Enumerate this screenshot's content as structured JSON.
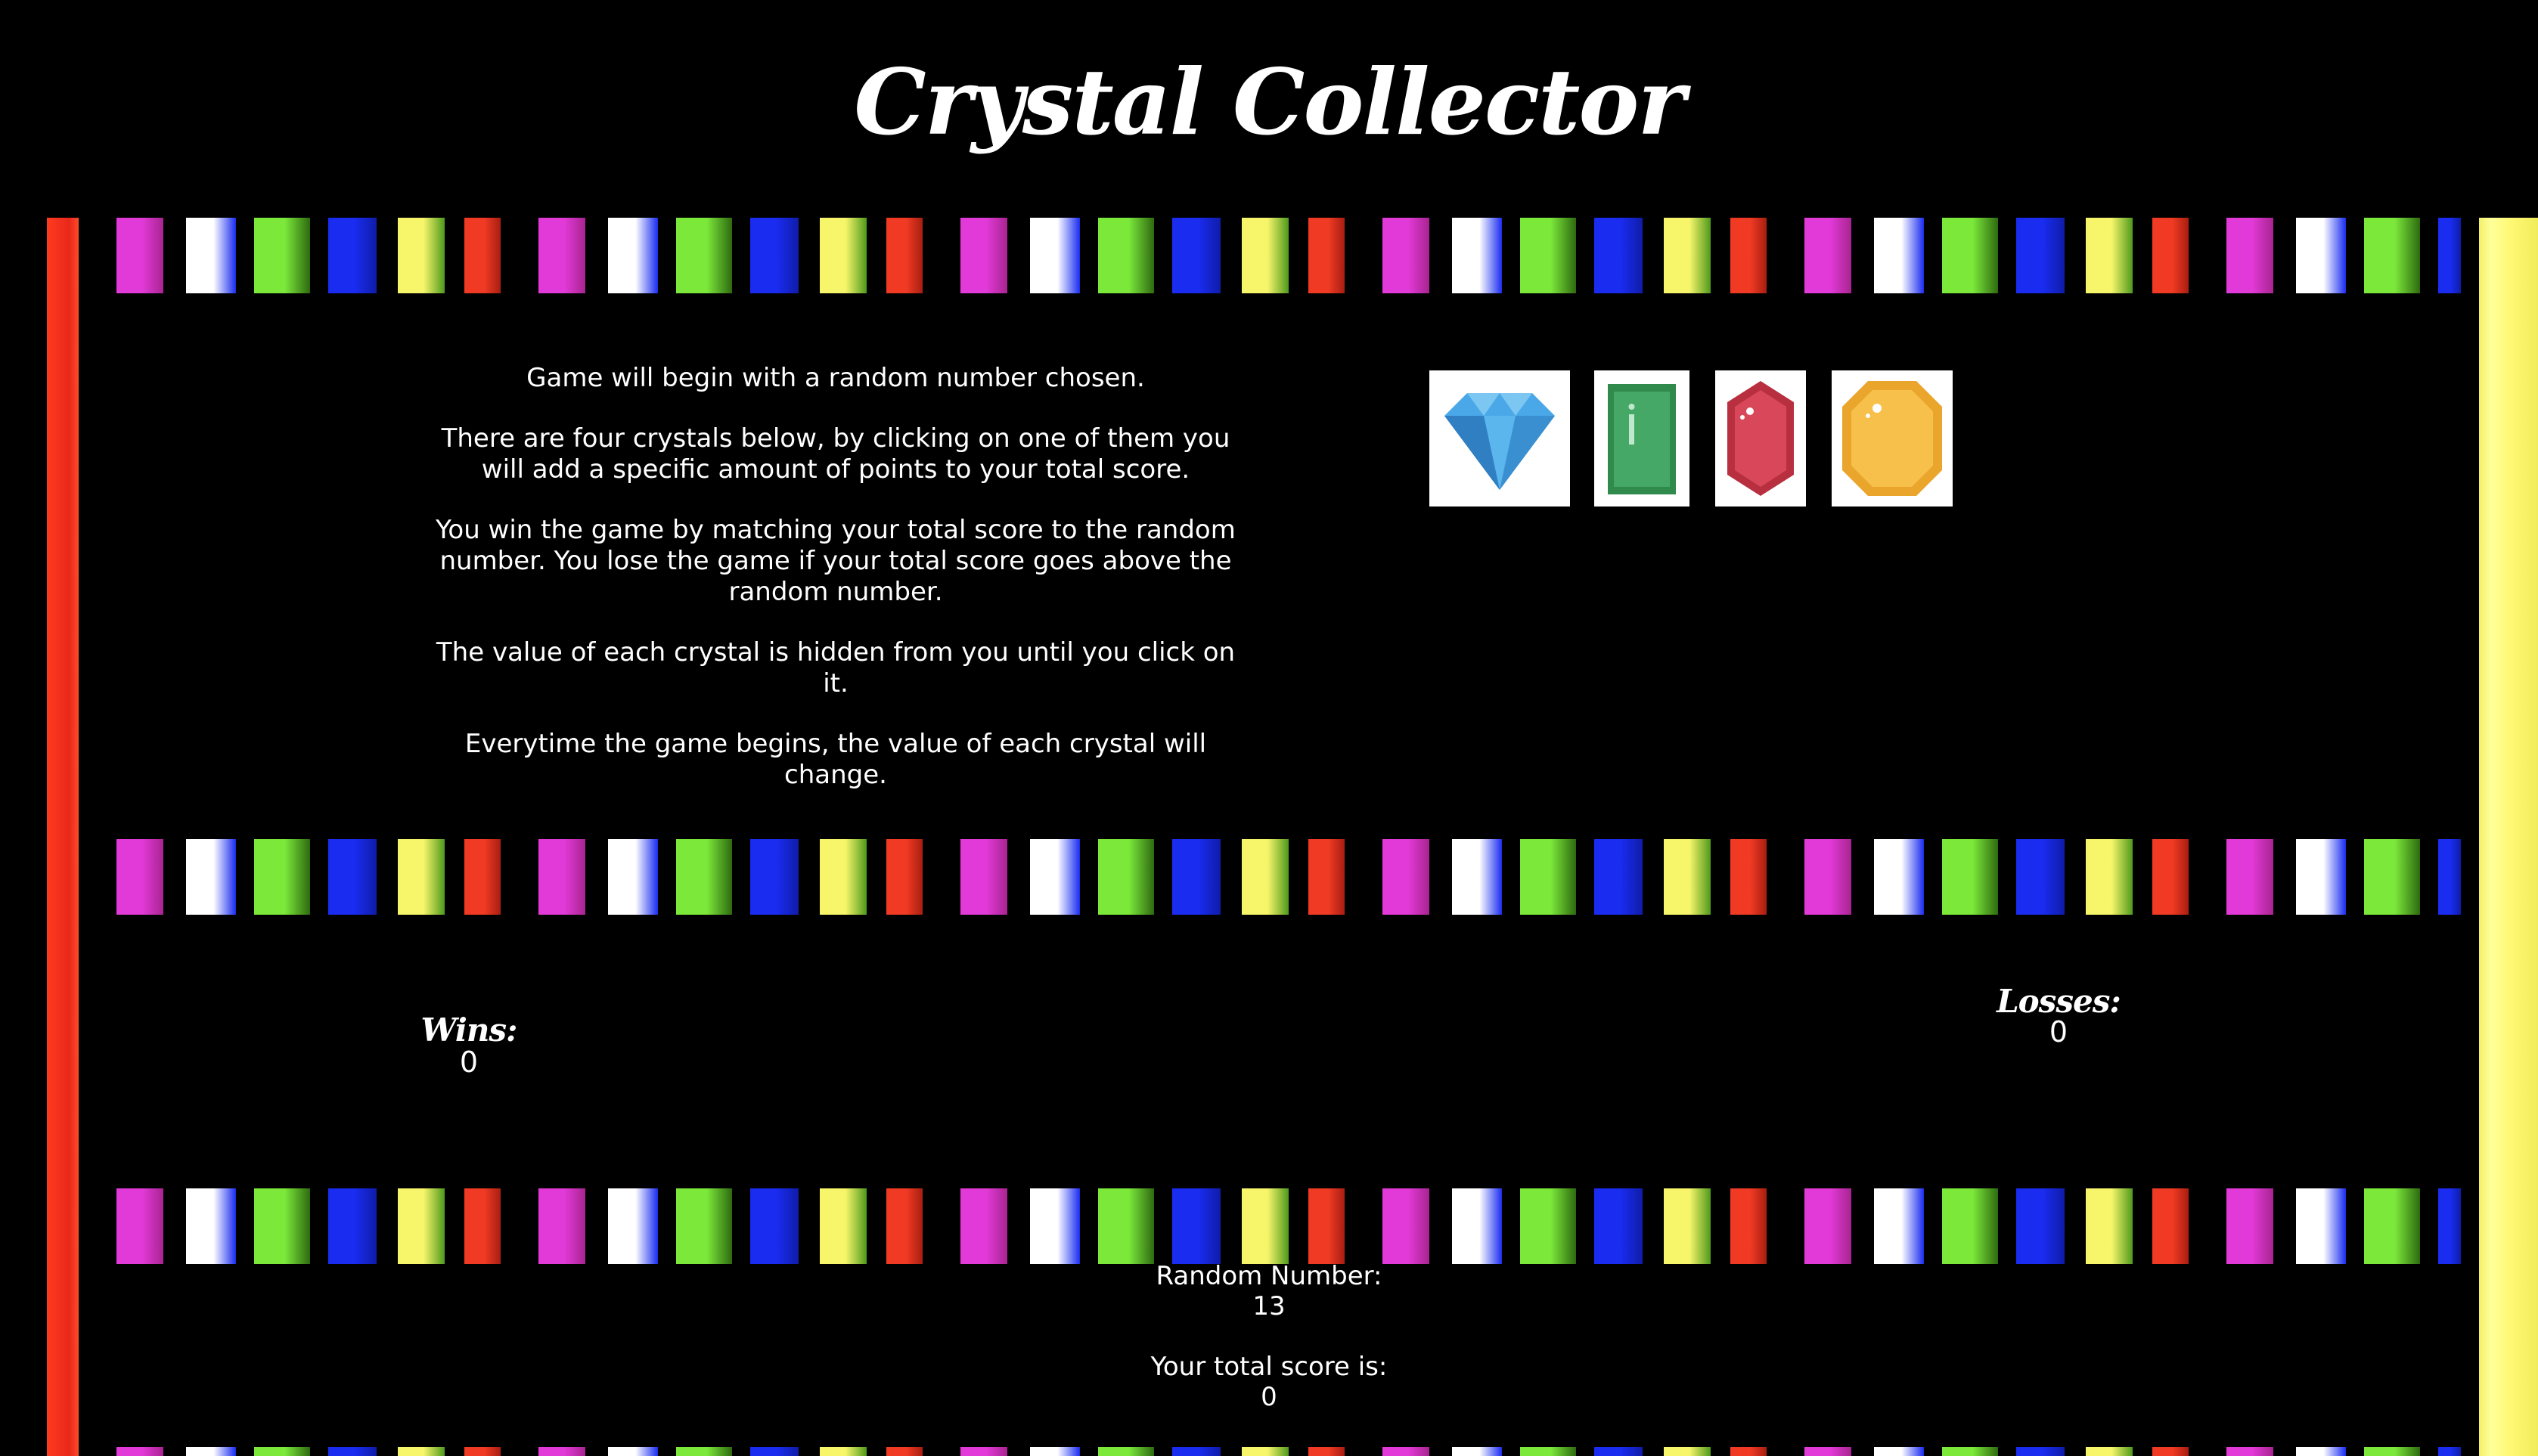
{
  "header": {
    "title": "Crystal Collector"
  },
  "instructions": {
    "p1": "Game will begin with a random number chosen.",
    "p2": "There are four crystals below, by clicking on one of them you will add a specific amount of points to your total score.",
    "p3": "You win the game by matching your total score to the random number. You lose the game if your total score goes above the random number.",
    "p4": "The value of each crystal is hidden from you until you click on it.",
    "p5": "Everytime the game begins, the value of each crystal will change."
  },
  "crystals": [
    {
      "name": "blue-diamond",
      "color": "#3a9de0"
    },
    {
      "name": "green-emerald",
      "color": "#3ea35f"
    },
    {
      "name": "red-ruby",
      "color": "#d63b4f"
    },
    {
      "name": "yellow-topaz",
      "color": "#f2b43a"
    }
  ],
  "scoreboard": {
    "wins_label": "Wins:",
    "wins_value": "0",
    "losses_label": "Losses:",
    "losses_value": "0"
  },
  "status": {
    "random_label": "Random Number:",
    "random_value": "13",
    "total_label": "Your total score is:",
    "total_value": "0"
  },
  "decor": {
    "stripe_colors": [
      "#e23ad8",
      "#ffffff",
      "#7be83a",
      "#1a2cf0",
      "#f7f56a",
      "#f03a24"
    ],
    "left_bar": "#e8281a",
    "right_bar": "#fff873"
  }
}
